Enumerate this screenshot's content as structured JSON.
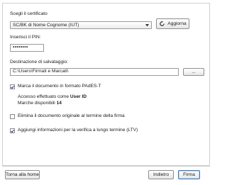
{
  "certificate": {
    "label": "Scegli il certificato",
    "selected": "SC/BK di Nome Cognome (IUT)",
    "refresh_label": "Aggiorna"
  },
  "pin": {
    "label": "Inserisci il PIN:",
    "value": "••••••••"
  },
  "destination": {
    "label": "Destinazione di salvataggio:",
    "path": "C:\\Users\\Firmati e Marcati\\",
    "browse_label": "..."
  },
  "options": {
    "pades": {
      "label": "Marca il documento in formato PAdES-T",
      "checked": true
    },
    "access_prefix": "Accesso effettuato come ",
    "access_user": "User ID",
    "marks_prefix": "Marche disponibili ",
    "marks_count": "14",
    "delete_original": {
      "label": "Elimina il documento originale al termine della firma",
      "checked": false
    },
    "ltv": {
      "label": "Aggiungi informazioni per la verifica a lungo termine (LTV)",
      "checked": true
    }
  },
  "footer": {
    "home_label": "Torna alla home",
    "back_label": "Indietro",
    "sign_label": "Firma"
  },
  "colors": {
    "check": "#1f3c88",
    "border": "#9a9a9a",
    "default_button_border": "#3a78c2"
  },
  "icons": {
    "refresh": "refresh-icon",
    "dropdown": "chevron-down-icon",
    "check": "checkmark-icon"
  }
}
